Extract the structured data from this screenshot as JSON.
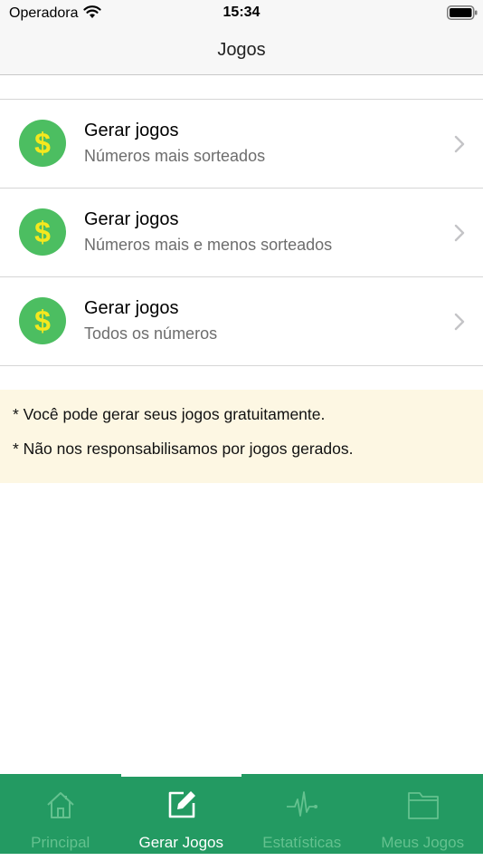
{
  "status_bar": {
    "carrier": "Operadora",
    "time": "15:34"
  },
  "nav": {
    "title": "Jogos"
  },
  "rows": [
    {
      "icon": "dollar-coin-icon",
      "symbol": "$",
      "title": "Gerar jogos",
      "subtitle": "Números mais sorteados"
    },
    {
      "icon": "dollar-coin-icon",
      "symbol": "$",
      "title": "Gerar jogos",
      "subtitle": "Números mais e menos sorteados"
    },
    {
      "icon": "dollar-coin-icon",
      "symbol": "$",
      "title": "Gerar jogos",
      "subtitle": "Todos os números"
    }
  ],
  "notice": {
    "lines": [
      "* Você pode gerar seus jogos gratuitamente.",
      "* Não nos responsabilisamos por jogos gerados."
    ]
  },
  "tabs": [
    {
      "icon": "home-icon",
      "label": "Principal",
      "active": false
    },
    {
      "icon": "edit-icon",
      "label": "Gerar Jogos",
      "active": true
    },
    {
      "icon": "pulse-icon",
      "label": "Estatísticas",
      "active": false
    },
    {
      "icon": "folder-icon",
      "label": "Meus Jogos",
      "active": false
    }
  ],
  "colors": {
    "accent_green": "#239a62",
    "coin_green": "#4cbe61",
    "coin_symbol_yellow": "#f5e81e",
    "inactive_tab": "#64c18f",
    "notice_background": "#fdf7e3"
  }
}
